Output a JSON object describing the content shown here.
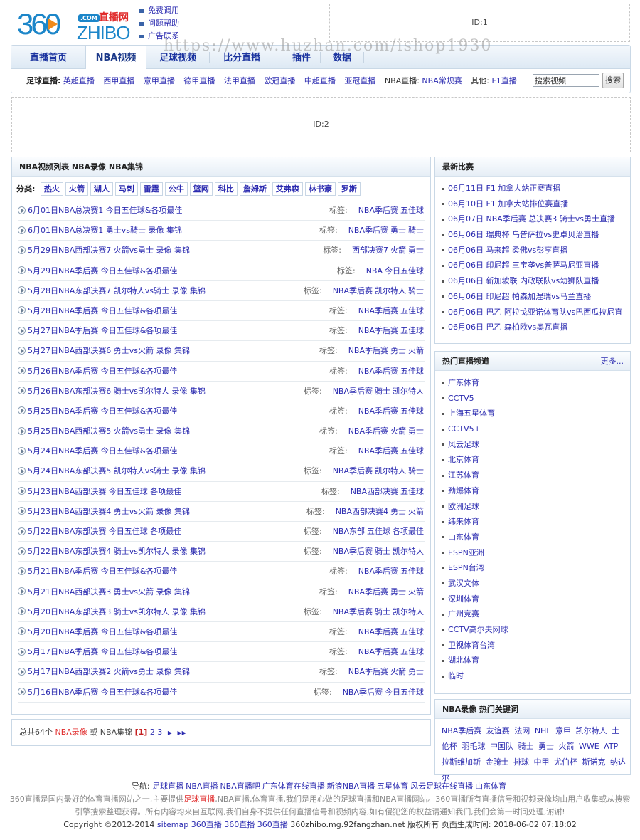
{
  "header": {
    "logo": {
      "number": "360",
      "com": ".COM",
      "cn": "直播网",
      "en": "ZHIBO"
    },
    "quick_links": [
      "免费调用",
      "问题帮助",
      "广告联系"
    ],
    "ad_slot_1": "ID:1"
  },
  "nav": {
    "tabs": [
      {
        "label": "直播首页",
        "active": false
      },
      {
        "label": "NBA视频",
        "active": true
      },
      {
        "label": "足球视频",
        "active": false
      },
      {
        "label": "比分直播",
        "active": false
      },
      {
        "label": "插件",
        "active": false
      },
      {
        "label": "数据",
        "active": false
      }
    ],
    "sub": {
      "football_label": "足球直播:",
      "football_links": [
        "英超直播",
        "西甲直播",
        "意甲直播",
        "德甲直播",
        "法甲直播",
        "欧冠直播",
        "中超直播",
        "亚冠直播"
      ],
      "nba_label": "NBA直播:",
      "nba_links": [
        "NBA常规赛"
      ],
      "other_label": "其他:",
      "other_links": [
        "F1直播"
      ]
    },
    "search": {
      "placeholder": "搜索视频",
      "value": "搜索视频",
      "button": "搜索"
    }
  },
  "ad_slot_2": "ID:2",
  "main": {
    "title": "NBA视频列表 NBA录像 NBA集锦",
    "category_label": "分类:",
    "categories": [
      "热火",
      "火箭",
      "湖人",
      "马刺",
      "雷霆",
      "公牛",
      "篮网",
      "科比",
      "詹姆斯",
      "艾弗森",
      "林书豪",
      "罗斯"
    ],
    "tag_label": "标签:",
    "rows": [
      {
        "title": "6月01日NBA总决赛1 今日五佳球&各项最佳",
        "tags": [
          "NBA季后赛",
          "五佳球"
        ]
      },
      {
        "title": "6月01日NBA总决赛1 勇士vs骑士 录像 集锦",
        "tags": [
          "NBA季后赛",
          "勇士",
          "骑士"
        ]
      },
      {
        "title": "5月29日NBA西部决赛7 火箭vs勇士 录像 集锦",
        "tags": [
          "西部决赛7",
          "火箭",
          "勇士"
        ]
      },
      {
        "title": "5月29日NBA季后赛 今日五佳球&各项最佳",
        "tags": [
          "NBA",
          "今日五佳球"
        ]
      },
      {
        "title": "5月28日NBA东部决赛7 凯尔特人vs骑士 录像 集锦",
        "tags": [
          "NBA季后赛",
          "凯尔特人",
          "骑士"
        ]
      },
      {
        "title": "5月28日NBA季后赛 今日五佳球&各项最佳",
        "tags": [
          "NBA季后赛",
          "五佳球"
        ]
      },
      {
        "title": "5月27日NBA季后赛 今日五佳球&各项最佳",
        "tags": [
          "NBA季后赛",
          "五佳球"
        ]
      },
      {
        "title": "5月27日NBA西部决赛6 勇士vs火箭 录像 集锦",
        "tags": [
          "NBA季后赛",
          "勇士",
          "火箭"
        ]
      },
      {
        "title": "5月26日NBA季后赛 今日五佳球&各项最佳",
        "tags": [
          "NBA季后赛",
          "五佳球"
        ]
      },
      {
        "title": "5月26日NBA东部决赛6 骑士vs凯尔特人 录像 集锦",
        "tags": [
          "NBA季后赛",
          "骑士",
          "凯尔特人"
        ]
      },
      {
        "title": "5月25日NBA季后赛 今日五佳球&各项最佳",
        "tags": [
          "NBA季后赛",
          "五佳球"
        ]
      },
      {
        "title": "5月25日NBA西部决赛5 火箭vs勇士 录像 集锦",
        "tags": [
          "NBA季后赛",
          "火箭",
          "勇士"
        ]
      },
      {
        "title": "5月24日NBA季后赛 今日五佳球&各项最佳",
        "tags": [
          "NBA季后赛",
          "五佳球"
        ]
      },
      {
        "title": "5月24日NBA东部决赛5 凯尔特人vs骑士 录像 集锦",
        "tags": [
          "NBA季后赛",
          "凯尔特人",
          "骑士"
        ]
      },
      {
        "title": "5月23日NBA西部决赛 今日五佳球 各项最佳",
        "tags": [
          "NBA西部决赛",
          "五佳球"
        ]
      },
      {
        "title": "5月23日NBA西部决赛4 勇士vs火箭 录像 集锦",
        "tags": [
          "NBA西部决赛4",
          "勇士",
          "火箭"
        ]
      },
      {
        "title": "5月22日NBA东部决赛 今日五佳球 各项最佳",
        "tags": [
          "NBA东部",
          "五佳球",
          "各项最佳"
        ]
      },
      {
        "title": "5月22日NBA东部决赛4 骑士vs凯尔特人 录像 集锦",
        "tags": [
          "NBA季后赛",
          "骑士",
          "凯尔特人"
        ]
      },
      {
        "title": "5月21日NBA季后赛 今日五佳球&各项最佳",
        "tags": [
          "NBA季后赛",
          "五佳球"
        ]
      },
      {
        "title": "5月21日NBA西部决赛3 勇士vs火箭 录像 集锦",
        "tags": [
          "NBA季后赛",
          "勇士",
          "火箭"
        ]
      },
      {
        "title": "5月20日NBA东部决赛3 骑士vs凯尔特人 录像 集锦",
        "tags": [
          "NBA季后赛",
          "骑士",
          "凯尔特人"
        ]
      },
      {
        "title": "5月20日NBA季后赛 今日五佳球&各项最佳",
        "tags": [
          "NBA季后赛",
          "五佳球"
        ]
      },
      {
        "title": "5月17日NBA季后赛 今日五佳球&各项最佳",
        "tags": [
          "NBA季后赛",
          "五佳球"
        ]
      },
      {
        "title": "5月17日NBA西部决赛2 火箭vs勇士 录像 集锦",
        "tags": [
          "NBA季后赛",
          "火箭",
          "勇士"
        ]
      },
      {
        "title": "5月16日NBA季后赛 今日五佳球&各项最佳",
        "tags": [
          "NBA季后赛",
          "今日五佳球"
        ]
      }
    ]
  },
  "pager": {
    "prefix": "总共64个",
    "red_text": "NBA录像",
    "middle": "或 NBA集锦",
    "current": "[1]",
    "pages": [
      "2",
      "3"
    ],
    "next": "▶",
    "last": "▶▶"
  },
  "latest": {
    "title": "最新比赛",
    "items": [
      "06月11日 F1 加拿大站正赛直播",
      "06月10日 F1 加拿大站排位赛直播",
      "06月07日 NBA季后赛 总决赛3 骑士vs勇士直播",
      "06月06日 瑞典杯 乌普萨拉vs史卓贝治直播",
      "06月06日 马来超 柔佛vs彭亨直播",
      "06月06日 印尼超 三宝垄vs普萨马尼亚直播",
      "06月06日 新加坡联 内政联队vs幼狮队直播",
      "06月06日 印尼超 帕森加涅瑞vs马兰直播",
      "06月06日 巴乙 阿拉戈亚诺体育队vs巴西瓜拉尼直",
      "06月06日 巴乙 森柏欧vs奥瓦直播"
    ]
  },
  "hot_channels": {
    "title": "热门直播频道",
    "more": "更多...",
    "items": [
      "广东体育",
      "CCTV5",
      "上海五星体育",
      "CCTV5+",
      "风云足球",
      "北京体育",
      "江苏体育",
      "劲爆体育",
      "欧洲足球",
      "纬来体育",
      "山东体育",
      "ESPN亚洲",
      "ESPN台湾",
      "武汉文体",
      "深圳体育",
      "广州竞赛",
      "CCTV高尔夫网球",
      "卫视体育台湾",
      "湖北体育",
      "临时"
    ]
  },
  "keywords": {
    "title": "NBA录像 热门关键词",
    "items": [
      "NBA季后赛",
      "友谊赛",
      "法网",
      "NHL",
      "意甲",
      "凯尔特人",
      "土伦杯",
      "羽毛球",
      "中国队",
      "骑士",
      "勇士",
      "火箭",
      "WWE",
      "ATP",
      "拉斯维加斯",
      "金骑士",
      "排球",
      "中甲",
      "尤伯杯",
      "斯诺克",
      "纳达尔"
    ]
  },
  "footer": {
    "nav_label": "导航:",
    "nav_links": [
      "足球直播",
      "NBA直播",
      "NBA直播吧",
      "广东体育在线直播",
      "新浪NBA直播",
      "五星体育",
      "风云足球在线直播",
      "山东体育"
    ],
    "desc_1a": "360直播是国内最好的体育直播网站之一,主要提供",
    "desc_1red": "足球直播",
    "desc_1b": ",NBA直播,体育直播,我们是用心做的足球直播和NBA直播网站。360直播所有直播信号和视频录像均由用户收集或从搜索",
    "desc_2": "引擎搜索整理获得。所有内容均来自互联网,我们自身不提供任何直播信号和视频内容,如有侵犯您的权益请通知我们,我们会第一时间处理,谢谢!",
    "copy_prefix": "Copyright ©2012-2014",
    "copy_links": [
      "sitemap",
      "360直播",
      "360直播",
      "360直播"
    ],
    "copy_suffix": "360zhibo.mg.92fangzhan.net 版权所有 页面生成时间: 2018-06-02 07:18:02"
  },
  "watermark": "https://www.huzhan.com/ishop1930"
}
